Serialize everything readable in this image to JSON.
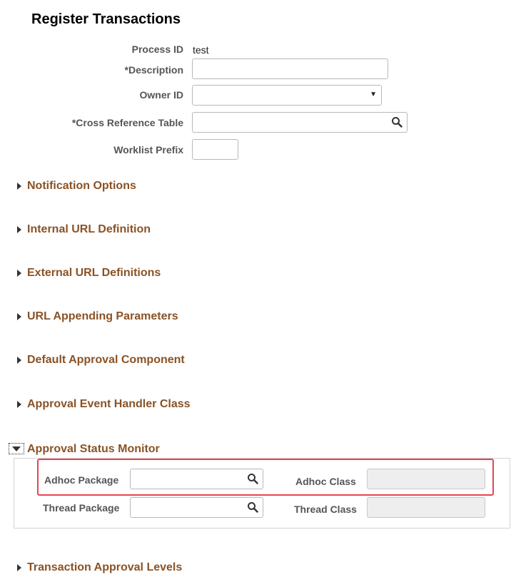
{
  "page": {
    "title": "Register Transactions"
  },
  "fields": {
    "process_id": {
      "label": "Process ID",
      "value": "test"
    },
    "description": {
      "label": "*Description",
      "value": ""
    },
    "owner_id": {
      "label": "Owner ID",
      "value": ""
    },
    "cross_reference_table": {
      "label": "*Cross Reference Table",
      "value": ""
    },
    "worklist_prefix": {
      "label": "Worklist Prefix",
      "value": ""
    }
  },
  "sections": [
    {
      "label": "Notification Options",
      "expanded": false
    },
    {
      "label": "Internal URL Definition",
      "expanded": false
    },
    {
      "label": "External URL Definitions",
      "expanded": false
    },
    {
      "label": "URL Appending Parameters",
      "expanded": false
    },
    {
      "label": "Default Approval Component",
      "expanded": false
    },
    {
      "label": "Approval Event Handler Class",
      "expanded": false
    },
    {
      "label": "Approval Status Monitor",
      "expanded": true
    },
    {
      "label": "Transaction Approval Levels",
      "expanded": false
    }
  ],
  "approval_status_monitor": {
    "adhoc_package": {
      "label": "Adhoc Package",
      "value": ""
    },
    "adhoc_class": {
      "label": "Adhoc Class",
      "value": ""
    },
    "thread_package": {
      "label": "Thread Package",
      "value": ""
    },
    "thread_class": {
      "label": "Thread Class",
      "value": ""
    }
  },
  "icons": {
    "search": "search-icon",
    "dropdown": "chevron-down-icon",
    "collapsed": "triangle-right-icon",
    "expanded": "triangle-down-icon"
  },
  "colors": {
    "section_label": "#8a5225",
    "highlight_border": "#e84550",
    "field_label": "#555555"
  }
}
